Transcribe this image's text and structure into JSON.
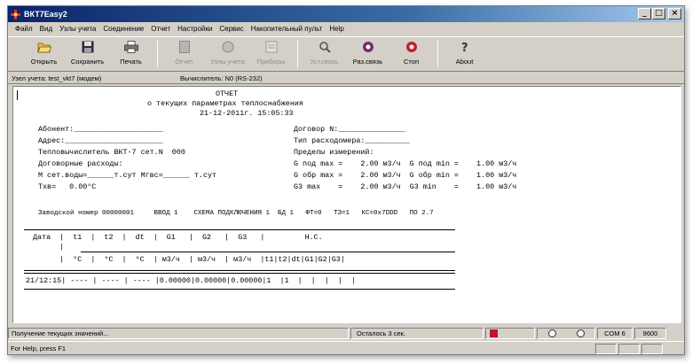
{
  "window": {
    "title": "ВКТ7Easy2"
  },
  "menu": [
    "Файл",
    "Вид",
    "Узлы учета",
    "Соединение",
    "Отчет",
    "Настройки",
    "Сервис",
    "Накопительный пульт",
    "Help"
  ],
  "toolbar": {
    "open": "Открыть",
    "save": "Сохранить",
    "print": "Печать",
    "report": "Отчет",
    "nodes": "Узлы учета",
    "devices": "Приборы",
    "connect": "Уст.связь",
    "disconnect": "Раз.связь",
    "stop": "Стоп",
    "about": "About"
  },
  "info": {
    "node": "Узел учета: test_vkt7  (модем)",
    "calc": "Вычислитель: N0 (RS-232)"
  },
  "report": {
    "lines": [
      "ОТЧЕТ",
      "о текущих параметрах теплоснабжения",
      "21-12-2011г. 15:05:33",
      "Абонент:____________________",
      "Договор N:_______________",
      "Адрес:______________________",
      "Тип расходомера:__________",
      "Тепловычислитель ВКТ-7 сет.N  000",
      "Пределы измерений:",
      "Договорные расходы:",
      "G под max =    2.00 м3/ч  G под min =    1.00 м3/ч",
      "M сет.воды=______т.сут Mгвс=______ т.сут",
      "G обр max =    2.00 м3/ч  G обр min =    1.00 м3/ч",
      "Tхв=   0.00°C",
      "G3 max    =    2.00 м3/ч  G3 min    =    1.00 м3/ч",
      "Заводской номер 00000001     ВВОД 1    СХЕМА ПОДКЛЮЧЕНИЯ 1  БД 1   ФТ=0   ТЗ=1   КС=0x7DDD   ПО 2.7",
      "Дата  |  t1  |  t2  |  dt  |  G1   |  G2   |  G3   |         Н.С.",
      "      |",
      "      |  °C  |  °C  |  °C  | м3/ч  | м3/ч  | м3/ч  |t1|t2|dt|G1|G2|G3|",
      "21/12:15| ---- | ---- | ---- |0.00000|0.00000|0.00000|1  |1  |  |  |  |  |"
    ]
  },
  "status": {
    "left": "Получение текущих значений...",
    "remaining": "Осталось 3 сек.",
    "com": "COM 6",
    "baud": "9600",
    "help": "For Help, press F1"
  }
}
